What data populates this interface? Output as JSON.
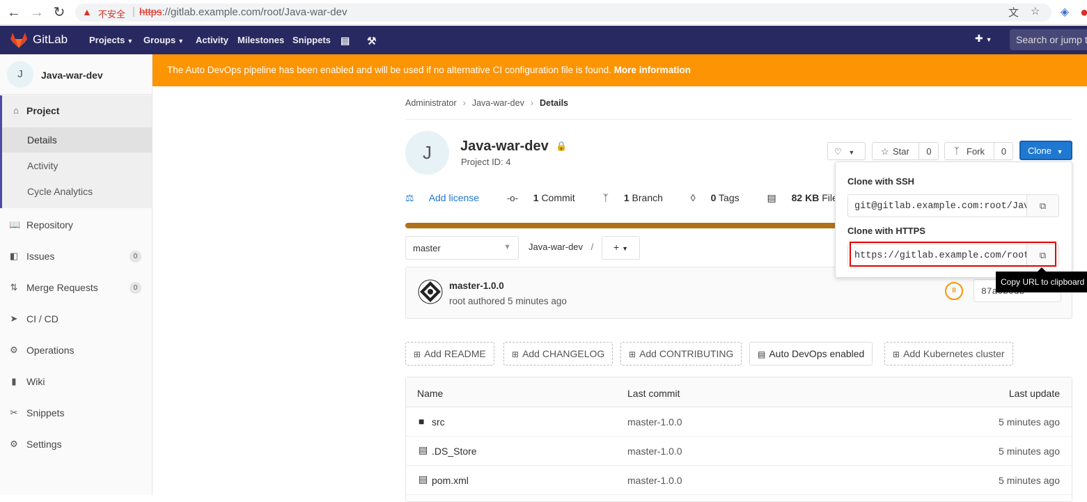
{
  "browser": {
    "insecure_label": "不安全",
    "url_scheme": "https",
    "url_rest": "://gitlab.example.com/root/Java-war-dev"
  },
  "navbar": {
    "brand": "GitLab",
    "items": [
      {
        "label": "Projects"
      },
      {
        "label": "Groups"
      },
      {
        "label": "Activity"
      },
      {
        "label": "Milestones"
      },
      {
        "label": "Snippets"
      }
    ],
    "search_placeholder": "Search or jump to"
  },
  "banner": {
    "text": "The Auto DevOps pipeline has been enabled and will be used if no alternative CI configuration file is found.",
    "link": "More information",
    "color": "#fc9403"
  },
  "sidebar": {
    "avatar_letter": "J",
    "project_name": "Java-war-dev",
    "section_label": "Project",
    "sub_items": [
      "Details",
      "Activity",
      "Cycle Analytics"
    ],
    "items": [
      {
        "label": "Repository"
      },
      {
        "label": "Issues",
        "count": "0"
      },
      {
        "label": "Merge Requests",
        "count": "0"
      },
      {
        "label": "CI / CD"
      },
      {
        "label": "Operations"
      },
      {
        "label": "Wiki"
      },
      {
        "label": "Snippets"
      },
      {
        "label": "Settings"
      }
    ]
  },
  "breadcrumb": [
    "Administrator",
    "Java-war-dev",
    "Details"
  ],
  "project": {
    "avatar_letter": "J",
    "title": "Java-war-dev",
    "id_text": "Project ID: 4"
  },
  "actions": {
    "star_label": "Star",
    "star_count": "0",
    "fork_label": "Fork",
    "fork_count": "0",
    "clone_label": "Clone",
    "accent": "#1f78d1"
  },
  "stats": {
    "add_license": "Add license",
    "commits_num": "1",
    "commits_label": "Commit",
    "branches_num": "1",
    "branches_label": "Branch",
    "tags_num": "0",
    "tags_label": "Tags",
    "files_num": "82 KB",
    "files_label": "Files"
  },
  "repo": {
    "branch": "master",
    "path": "Java-war-dev",
    "path_sep": "/"
  },
  "commit": {
    "title": "master-1.0.0",
    "meta": "root authored 5 minutes ago",
    "sha": "87a0b0db"
  },
  "quick_actions": [
    "Add README",
    "Add CHANGELOG",
    "Add CONTRIBUTING",
    "Auto DevOps enabled",
    "Add Kubernetes cluster"
  ],
  "files": {
    "headers": [
      "Name",
      "Last commit",
      "Last update"
    ],
    "rows": [
      {
        "name": "src",
        "commit": "master-1.0.0",
        "updated": "5 minutes ago",
        "icon": "folder-icon"
      },
      {
        "name": ".DS_Store",
        "commit": "master-1.0.0",
        "updated": "5 minutes ago",
        "icon": "file-icon"
      },
      {
        "name": "pom.xml",
        "commit": "master-1.0.0",
        "updated": "5 minutes ago",
        "icon": "file-icon"
      }
    ]
  },
  "clone_dropdown": {
    "ssh_label": "Clone with SSH",
    "ssh_url": "git@gitlab.example.com:root/Java-war-dev.git",
    "https_label": "Clone with HTTPS",
    "https_url": "https://gitlab.example.com/root/Java-war-dev.git"
  },
  "tooltip": "Copy URL to clipboard"
}
